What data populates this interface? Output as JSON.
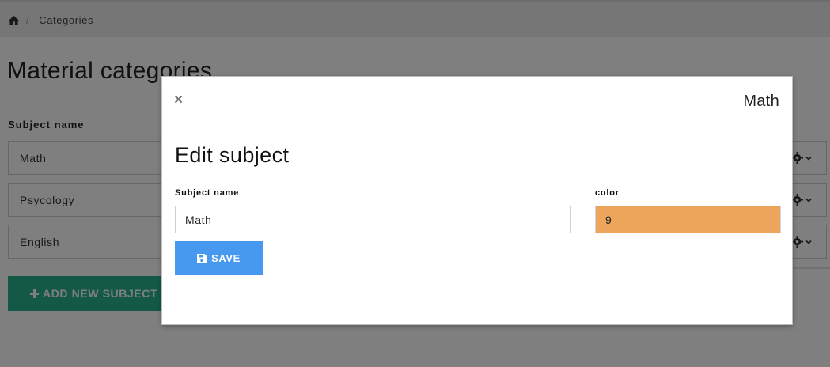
{
  "breadcrumb": {
    "home_icon": "home-icon",
    "separator": "/",
    "current": "Categories"
  },
  "page": {
    "title": "Material categories",
    "column_header": "Subject name",
    "subjects": [
      {
        "label": "Math"
      },
      {
        "label": "Psycology"
      },
      {
        "label": "English"
      }
    ],
    "row_action_icons": [
      "gear-icon",
      "chevron-down-icon"
    ],
    "add_button_label": "ADD NEW SUBJECT",
    "add_button_color": "#27b38a"
  },
  "modal": {
    "close_label": "×",
    "subject_title": "Math",
    "heading": "Edit subject",
    "subject_name_label": "Subject name",
    "subject_name_value": "Math",
    "color_label": "color",
    "color_value": "9",
    "color_swatch": "#eca55a",
    "save_label": "SAVE",
    "save_button_color": "#4799f0"
  }
}
